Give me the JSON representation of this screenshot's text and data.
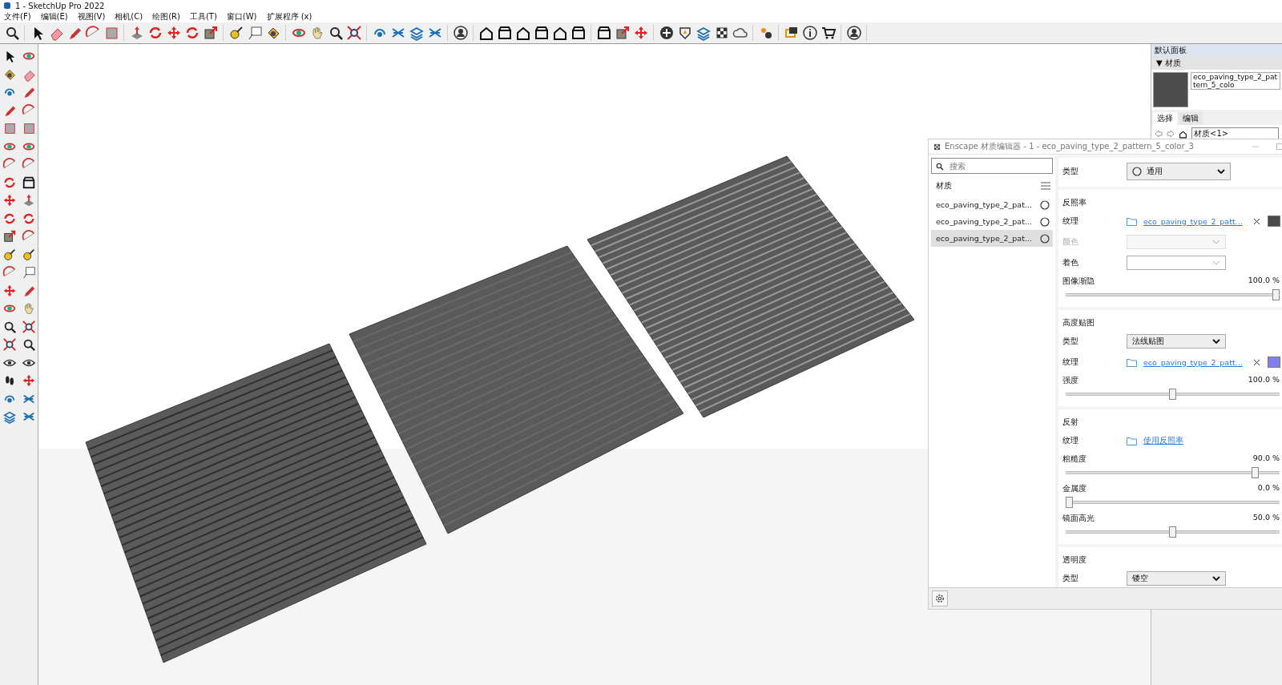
{
  "window": {
    "title": "1 - SketchUp Pro 2022"
  },
  "menu": [
    "文件(F)",
    "编辑(E)",
    "视图(V)",
    "相机(C)",
    "绘图(R)",
    "工具(T)",
    "窗口(W)",
    "扩展程序 (x)"
  ],
  "tray": {
    "title": "默认面板",
    "section": "▼ 材质",
    "material_name": "eco_paving_type_2_pattern_5_colo",
    "tabs": [
      {
        "label": "选择",
        "selected": true
      },
      {
        "label": "编辑",
        "selected": false
      }
    ],
    "collection": "材质<1>"
  },
  "material_editor": {
    "title": "Enscape 材质编辑器 - 1 - eco_paving_type_2_pattern_5_color_3",
    "search": {
      "placeholder": "搜索"
    },
    "list_title": "材质",
    "materials": [
      {
        "name": "eco_paving_type_2_pat...",
        "selected": false
      },
      {
        "name": "eco_paving_type_2_pat...",
        "selected": false
      },
      {
        "name": "eco_paving_type_2_pat...",
        "selected": true
      }
    ],
    "sections": [
      {
        "rows": [
          {
            "kind": "dropdown",
            "label": "类型",
            "value": "通用",
            "disabled": false
          }
        ]
      },
      {
        "title": "反照率",
        "rows": [
          {
            "kind": "texture",
            "label": "纹理",
            "value": "eco_paving_type_2_patt...",
            "color": "#4a4a4a"
          },
          {
            "kind": "dropdown",
            "label": "颜色",
            "value": "",
            "disabled": true
          },
          {
            "kind": "dropdown",
            "label": "着色",
            "value": "",
            "disabled": false
          },
          {
            "kind": "slider",
            "label": "图像渐隐",
            "reading": "100.0 %",
            "level": 1
          }
        ]
      },
      {
        "title": "高度贴图",
        "rows": [
          {
            "kind": "dropdown",
            "label": "类型",
            "value": "法线贴图",
            "disabled": false
          },
          {
            "kind": "texture",
            "label": "纹理",
            "value": "eco_paving_type_2_patt...",
            "color": "#8080f0"
          },
          {
            "kind": "slider",
            "label": "强度",
            "reading": "100.0 %",
            "level": 0.5
          }
        ]
      },
      {
        "title": "反射",
        "rows": [
          {
            "kind": "texture",
            "label": "纹理",
            "value": "使用反照率"
          },
          {
            "kind": "slider",
            "label": "粗糙度",
            "reading": "90.0 %",
            "level": 0.9
          },
          {
            "kind": "slider",
            "label": "金属度",
            "reading": "0.0 %",
            "level": 0
          },
          {
            "kind": "slider",
            "label": "镜面高光",
            "reading": "50.0 %",
            "level": 0.5
          }
        ]
      },
      {
        "title": "透明度",
        "rows": [
          {
            "kind": "dropdown",
            "label": "类型",
            "value": "镂空",
            "disabled": false
          }
        ]
      }
    ]
  }
}
